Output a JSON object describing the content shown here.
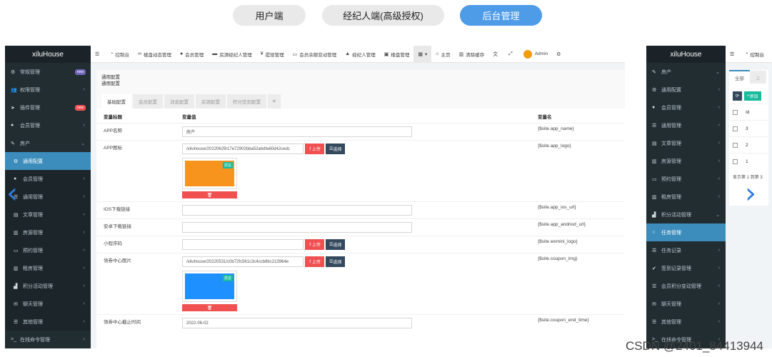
{
  "top_tabs": [
    {
      "label": "用户端",
      "active": false
    },
    {
      "label": "经纪人端(高级授权)",
      "active": false
    },
    {
      "label": "后台管理",
      "active": true
    }
  ],
  "colors": {
    "accent": "#4e9be8",
    "sidebar": "#222d32",
    "active_item": "#3c8dbc",
    "danger": "#f05050",
    "navy": "#34495e"
  },
  "left_panel": {
    "brand": "xiluHouse",
    "sidebar": [
      {
        "icon": "gears-icon",
        "label": "常规管理",
        "badge": "new"
      },
      {
        "icon": "users-icon",
        "label": "权限管理"
      },
      {
        "icon": "rocket-icon",
        "label": "插件管理",
        "badge": "new"
      },
      {
        "icon": "user-circle-icon",
        "label": "会员管理"
      },
      {
        "icon": "wrench-icon",
        "label": "房产",
        "expanded": true
      },
      {
        "icon": "gear-icon",
        "label": "通用配置",
        "active": true,
        "sub": true
      },
      {
        "icon": "user-circle-icon",
        "label": "会员管理",
        "sub": true
      },
      {
        "icon": "list-icon",
        "label": "通用管理",
        "sub": true
      },
      {
        "icon": "file-icon",
        "label": "文章管理",
        "sub": true
      },
      {
        "icon": "building-icon",
        "label": "房源管理",
        "sub": true
      },
      {
        "icon": "desktop-icon",
        "label": "预约管理",
        "sub": true
      },
      {
        "icon": "building-icon",
        "label": "租房管理",
        "sub": true
      },
      {
        "icon": "chart-icon",
        "label": "积分活动管理",
        "sub": true
      },
      {
        "icon": "chat-icon",
        "label": "聊天管理",
        "sub": true
      },
      {
        "icon": "list-icon",
        "label": "其他管理",
        "sub": true
      },
      {
        "icon": "terminal-icon",
        "label": "在线命令管理"
      }
    ],
    "header_nav": [
      {
        "icon": "menu-icon",
        "label": ""
      },
      {
        "icon": "dashboard-icon",
        "label": "控制台"
      },
      {
        "icon": "link-icon",
        "label": "楼盘动态管理"
      },
      {
        "icon": "user-icon",
        "label": "会员管理"
      },
      {
        "icon": "car-icon",
        "label": "房源经纪人管理"
      },
      {
        "icon": "yen-icon",
        "label": "提现管理"
      },
      {
        "icon": "card-icon",
        "label": "会员余额变动管理"
      },
      {
        "icon": "lock-icon",
        "label": "经纪人管理"
      },
      {
        "icon": "save-icon",
        "label": "楼盘管理"
      },
      {
        "icon": "grid-icon",
        "label": "▾"
      },
      {
        "icon": "home-icon",
        "label": "主页"
      },
      {
        "icon": "trash-icon",
        "label": "清除缓存"
      },
      {
        "icon": "translate-icon",
        "label": ""
      },
      {
        "icon": "fullscreen-icon",
        "label": ""
      },
      {
        "icon": "avatar",
        "label": "Admin"
      },
      {
        "icon": "cogs-icon",
        "label": ""
      }
    ],
    "content": {
      "title": "通用配置",
      "subtitle": "通用配置",
      "tabs": [
        "基础配置",
        "会员配置",
        "消息配置",
        "房源配置",
        "积分签到配置",
        "+"
      ],
      "columns": [
        "变量标题",
        "变量值",
        "变量名"
      ],
      "upload_label": "上传",
      "select_label": "选择",
      "rows": [
        {
          "title": "APP名称",
          "value": "房产",
          "name": "{$site.app_name}",
          "type": "text"
        },
        {
          "title": "APP图标",
          "value": "/xiluhouse/20220629/17e72902bba52abdfa60d42cedc",
          "name": "{$site.app_logo}",
          "type": "image",
          "thumb_tag": "前言"
        },
        {
          "title": "IOS下载链接",
          "value": "",
          "name": "{$site.app_ios_url}",
          "type": "text"
        },
        {
          "title": "安卓下载链接",
          "value": "",
          "name": "{$site.app_andriod_url}",
          "type": "text"
        },
        {
          "title": "小程序码",
          "value": "",
          "name": "{$site.wxmini_logo}",
          "type": "upload"
        },
        {
          "title": "领券中心图片",
          "value": "/xiluhouse/20220531/c0b72fc561c3c4ccb8bc213964e",
          "name": "{$site.coupon_img}",
          "type": "image",
          "thumb_tag": "前言"
        },
        {
          "title": "领券中心截止时间",
          "value": "2022-06-02",
          "name": "{$site.coupon_end_time}",
          "type": "text"
        }
      ]
    }
  },
  "right_panel": {
    "brand": "xiluHouse",
    "sidebar": [
      {
        "icon": "wrench-icon",
        "label": "房产",
        "expanded": true
      },
      {
        "icon": "gear-icon",
        "label": "通用配置"
      },
      {
        "icon": "user-circle-icon",
        "label": "会员管理"
      },
      {
        "icon": "list-icon",
        "label": "通用管理"
      },
      {
        "icon": "file-icon",
        "label": "文章管理"
      },
      {
        "icon": "building-icon",
        "label": "房源管理"
      },
      {
        "icon": "desktop-icon",
        "label": "预约管理"
      },
      {
        "icon": "building-icon",
        "label": "租房管理"
      },
      {
        "icon": "chart-icon",
        "label": "积分活动管理",
        "expanded": true
      },
      {
        "icon": "circle-icon",
        "label": "任务管理",
        "active": true
      },
      {
        "icon": "list-icon",
        "label": "任务记录"
      },
      {
        "icon": "check-icon",
        "label": "签到记录管理"
      },
      {
        "icon": "list-icon",
        "label": "会员积分变动管理"
      },
      {
        "icon": "chat-icon",
        "label": "聊天管理"
      },
      {
        "icon": "list-icon",
        "label": "其他管理"
      },
      {
        "icon": "terminal-icon",
        "label": "在线命令管理"
      }
    ],
    "header_nav": [
      {
        "icon": "menu-icon",
        "label": ""
      },
      {
        "icon": "dashboard-icon",
        "label": "控制台"
      }
    ],
    "tabs": [
      "全部",
      "上"
    ],
    "refresh_label": "",
    "add_label": "添加",
    "id_header": "Id",
    "rows": [
      "3",
      "2",
      "1"
    ],
    "footer": "显示第 1 到第 3"
  },
  "watermark": "CSDN @2401_84413944"
}
